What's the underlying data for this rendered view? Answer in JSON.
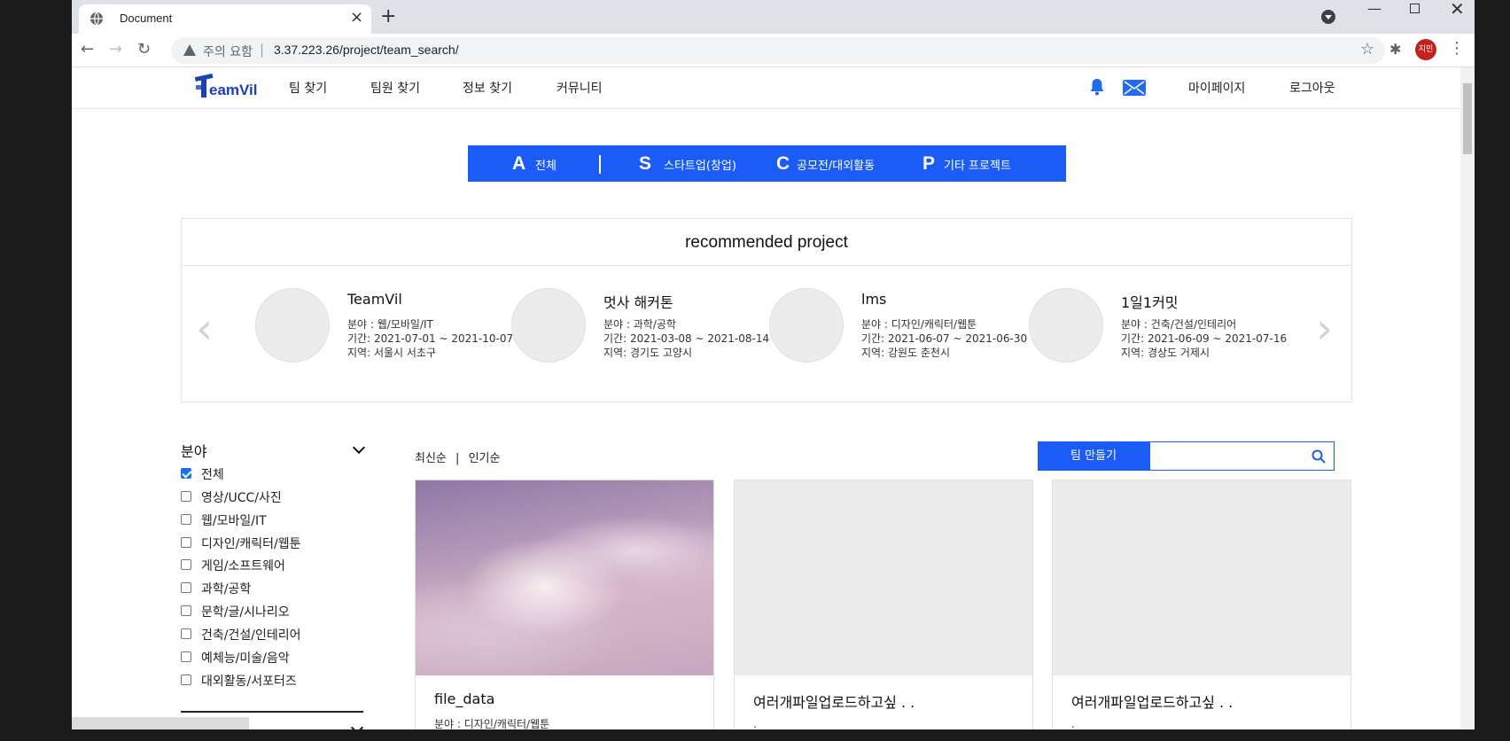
{
  "browser": {
    "tab_title": "Document",
    "url_warning": "주의 요함",
    "url": "3.37.223.26/project/team_search/",
    "profile_initials": "지민"
  },
  "header": {
    "logo_text": "eamVil",
    "nav": [
      "팀 찾기",
      "팀원 찾기",
      "정보 찾기",
      "커뮤니티"
    ],
    "mypage": "마이페이지",
    "logout": "로그아웃",
    "accent": "#1a5cf5"
  },
  "categories": [
    {
      "letter": "A",
      "label": "전체"
    },
    {
      "letter": "S",
      "label": "스타트업(창업)"
    },
    {
      "letter": "C",
      "label": "공모전/대외활동"
    },
    {
      "letter": "P",
      "label": "기타 프로젝트"
    }
  ],
  "recommended": {
    "title": "recommended project",
    "prev": "‹",
    "next": "›",
    "projects": [
      {
        "name": "TeamVil",
        "field": "분야 : 웹/모바일/IT",
        "period": "기간: 2021-07-01 ~ 2021-10-07",
        "region": "지역: 서울시 서초구"
      },
      {
        "name": "멋사 해커톤",
        "field": "분야 : 과학/공학",
        "period": "기간: 2021-03-08 ~ 2021-08-14",
        "region": "지역: 경기도 고양시"
      },
      {
        "name": "lms",
        "field": "분야 : 디자인/캐릭터/웹툰",
        "period": "기간: 2021-06-07 ~ 2021-06-30",
        "region": "지역: 강원도 춘천시"
      },
      {
        "name": "1일1커밋",
        "field": "분야 : 건축/건설/인테리어",
        "period": "기간: 2021-06-09 ~ 2021-07-16",
        "region": "지역: 경상도 거제시"
      }
    ]
  },
  "filter": {
    "title": "분야",
    "options": [
      {
        "label": "전체",
        "checked": true
      },
      {
        "label": "영상/UCC/사진",
        "checked": false
      },
      {
        "label": "웹/모바일/IT",
        "checked": false
      },
      {
        "label": "디자인/캐릭터/웹툰",
        "checked": false
      },
      {
        "label": "게임/소프트웨어",
        "checked": false
      },
      {
        "label": "과학/공학",
        "checked": false
      },
      {
        "label": "문학/글/시나리오",
        "checked": false
      },
      {
        "label": "건축/건설/인테리어",
        "checked": false
      },
      {
        "label": "예체능/미술/음악",
        "checked": false
      },
      {
        "label": "대외활동/서포터즈",
        "checked": false
      }
    ]
  },
  "toolbar": {
    "sort_latest": "최신순",
    "sort_sep": "|",
    "sort_popular": "인기순",
    "make_team": "팀 만들기"
  },
  "cards": [
    {
      "title": "file_data",
      "meta": "분야 : 디자인/캐릭터/웹툰",
      "has_image": true
    },
    {
      "title": "여러개파일업로드하고싶 . .",
      "meta": ".",
      "has_image": false
    },
    {
      "title": "여러개파일업로드하고싶 . .",
      "meta": ".",
      "has_image": false
    }
  ]
}
